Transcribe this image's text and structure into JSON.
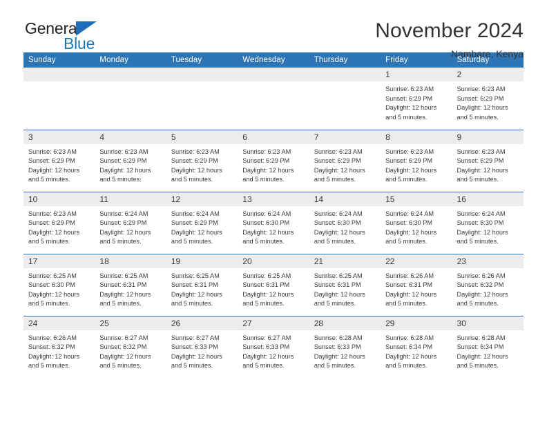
{
  "logo": {
    "word_one": "General",
    "word_two": "Blue",
    "triangle_color": "#1b6fba",
    "text_color_one": "#231f20",
    "text_color_two": "#1878be",
    "triangle_icon": "triangle-icon"
  },
  "header": {
    "title": "November 2024",
    "subtitle": "Nambare, Kenya"
  },
  "theme": {
    "header_blue": "#2e75b6",
    "daynum_band": "#ececec",
    "text": "#3a3a3a"
  },
  "calendar": {
    "weekday_headers": [
      "Sunday",
      "Monday",
      "Tuesday",
      "Wednesday",
      "Thursday",
      "Friday",
      "Saturday"
    ],
    "labels": {
      "sunrise": "Sunrise:",
      "sunset": "Sunset:",
      "daylight": "Daylight:"
    },
    "weeks": [
      [
        {
          "day": "",
          "empty": true
        },
        {
          "day": "",
          "empty": true
        },
        {
          "day": "",
          "empty": true
        },
        {
          "day": "",
          "empty": true
        },
        {
          "day": "",
          "empty": true
        },
        {
          "day": "1",
          "sunrise": "Sunrise: 6:23 AM",
          "sunset": "Sunset: 6:29 PM",
          "daylight_line1": "Daylight: 12 hours",
          "daylight_line2": "and 5 minutes."
        },
        {
          "day": "2",
          "sunrise": "Sunrise: 6:23 AM",
          "sunset": "Sunset: 6:29 PM",
          "daylight_line1": "Daylight: 12 hours",
          "daylight_line2": "and 5 minutes."
        }
      ],
      [
        {
          "day": "3",
          "sunrise": "Sunrise: 6:23 AM",
          "sunset": "Sunset: 6:29 PM",
          "daylight_line1": "Daylight: 12 hours",
          "daylight_line2": "and 5 minutes."
        },
        {
          "day": "4",
          "sunrise": "Sunrise: 6:23 AM",
          "sunset": "Sunset: 6:29 PM",
          "daylight_line1": "Daylight: 12 hours",
          "daylight_line2": "and 5 minutes."
        },
        {
          "day": "5",
          "sunrise": "Sunrise: 6:23 AM",
          "sunset": "Sunset: 6:29 PM",
          "daylight_line1": "Daylight: 12 hours",
          "daylight_line2": "and 5 minutes."
        },
        {
          "day": "6",
          "sunrise": "Sunrise: 6:23 AM",
          "sunset": "Sunset: 6:29 PM",
          "daylight_line1": "Daylight: 12 hours",
          "daylight_line2": "and 5 minutes."
        },
        {
          "day": "7",
          "sunrise": "Sunrise: 6:23 AM",
          "sunset": "Sunset: 6:29 PM",
          "daylight_line1": "Daylight: 12 hours",
          "daylight_line2": "and 5 minutes."
        },
        {
          "day": "8",
          "sunrise": "Sunrise: 6:23 AM",
          "sunset": "Sunset: 6:29 PM",
          "daylight_line1": "Daylight: 12 hours",
          "daylight_line2": "and 5 minutes."
        },
        {
          "day": "9",
          "sunrise": "Sunrise: 6:23 AM",
          "sunset": "Sunset: 6:29 PM",
          "daylight_line1": "Daylight: 12 hours",
          "daylight_line2": "and 5 minutes."
        }
      ],
      [
        {
          "day": "10",
          "sunrise": "Sunrise: 6:23 AM",
          "sunset": "Sunset: 6:29 PM",
          "daylight_line1": "Daylight: 12 hours",
          "daylight_line2": "and 5 minutes."
        },
        {
          "day": "11",
          "sunrise": "Sunrise: 6:24 AM",
          "sunset": "Sunset: 6:29 PM",
          "daylight_line1": "Daylight: 12 hours",
          "daylight_line2": "and 5 minutes."
        },
        {
          "day": "12",
          "sunrise": "Sunrise: 6:24 AM",
          "sunset": "Sunset: 6:29 PM",
          "daylight_line1": "Daylight: 12 hours",
          "daylight_line2": "and 5 minutes."
        },
        {
          "day": "13",
          "sunrise": "Sunrise: 6:24 AM",
          "sunset": "Sunset: 6:30 PM",
          "daylight_line1": "Daylight: 12 hours",
          "daylight_line2": "and 5 minutes."
        },
        {
          "day": "14",
          "sunrise": "Sunrise: 6:24 AM",
          "sunset": "Sunset: 6:30 PM",
          "daylight_line1": "Daylight: 12 hours",
          "daylight_line2": "and 5 minutes."
        },
        {
          "day": "15",
          "sunrise": "Sunrise: 6:24 AM",
          "sunset": "Sunset: 6:30 PM",
          "daylight_line1": "Daylight: 12 hours",
          "daylight_line2": "and 5 minutes."
        },
        {
          "day": "16",
          "sunrise": "Sunrise: 6:24 AM",
          "sunset": "Sunset: 6:30 PM",
          "daylight_line1": "Daylight: 12 hours",
          "daylight_line2": "and 5 minutes."
        }
      ],
      [
        {
          "day": "17",
          "sunrise": "Sunrise: 6:25 AM",
          "sunset": "Sunset: 6:30 PM",
          "daylight_line1": "Daylight: 12 hours",
          "daylight_line2": "and 5 minutes."
        },
        {
          "day": "18",
          "sunrise": "Sunrise: 6:25 AM",
          "sunset": "Sunset: 6:31 PM",
          "daylight_line1": "Daylight: 12 hours",
          "daylight_line2": "and 5 minutes."
        },
        {
          "day": "19",
          "sunrise": "Sunrise: 6:25 AM",
          "sunset": "Sunset: 6:31 PM",
          "daylight_line1": "Daylight: 12 hours",
          "daylight_line2": "and 5 minutes."
        },
        {
          "day": "20",
          "sunrise": "Sunrise: 6:25 AM",
          "sunset": "Sunset: 6:31 PM",
          "daylight_line1": "Daylight: 12 hours",
          "daylight_line2": "and 5 minutes."
        },
        {
          "day": "21",
          "sunrise": "Sunrise: 6:25 AM",
          "sunset": "Sunset: 6:31 PM",
          "daylight_line1": "Daylight: 12 hours",
          "daylight_line2": "and 5 minutes."
        },
        {
          "day": "22",
          "sunrise": "Sunrise: 6:26 AM",
          "sunset": "Sunset: 6:31 PM",
          "daylight_line1": "Daylight: 12 hours",
          "daylight_line2": "and 5 minutes."
        },
        {
          "day": "23",
          "sunrise": "Sunrise: 6:26 AM",
          "sunset": "Sunset: 6:32 PM",
          "daylight_line1": "Daylight: 12 hours",
          "daylight_line2": "and 5 minutes."
        }
      ],
      [
        {
          "day": "24",
          "sunrise": "Sunrise: 6:26 AM",
          "sunset": "Sunset: 6:32 PM",
          "daylight_line1": "Daylight: 12 hours",
          "daylight_line2": "and 5 minutes."
        },
        {
          "day": "25",
          "sunrise": "Sunrise: 6:27 AM",
          "sunset": "Sunset: 6:32 PM",
          "daylight_line1": "Daylight: 12 hours",
          "daylight_line2": "and 5 minutes."
        },
        {
          "day": "26",
          "sunrise": "Sunrise: 6:27 AM",
          "sunset": "Sunset: 6:33 PM",
          "daylight_line1": "Daylight: 12 hours",
          "daylight_line2": "and 5 minutes."
        },
        {
          "day": "27",
          "sunrise": "Sunrise: 6:27 AM",
          "sunset": "Sunset: 6:33 PM",
          "daylight_line1": "Daylight: 12 hours",
          "daylight_line2": "and 5 minutes."
        },
        {
          "day": "28",
          "sunrise": "Sunrise: 6:28 AM",
          "sunset": "Sunset: 6:33 PM",
          "daylight_line1": "Daylight: 12 hours",
          "daylight_line2": "and 5 minutes."
        },
        {
          "day": "29",
          "sunrise": "Sunrise: 6:28 AM",
          "sunset": "Sunset: 6:34 PM",
          "daylight_line1": "Daylight: 12 hours",
          "daylight_line2": "and 5 minutes."
        },
        {
          "day": "30",
          "sunrise": "Sunrise: 6:28 AM",
          "sunset": "Sunset: 6:34 PM",
          "daylight_line1": "Daylight: 12 hours",
          "daylight_line2": "and 5 minutes."
        }
      ]
    ]
  }
}
